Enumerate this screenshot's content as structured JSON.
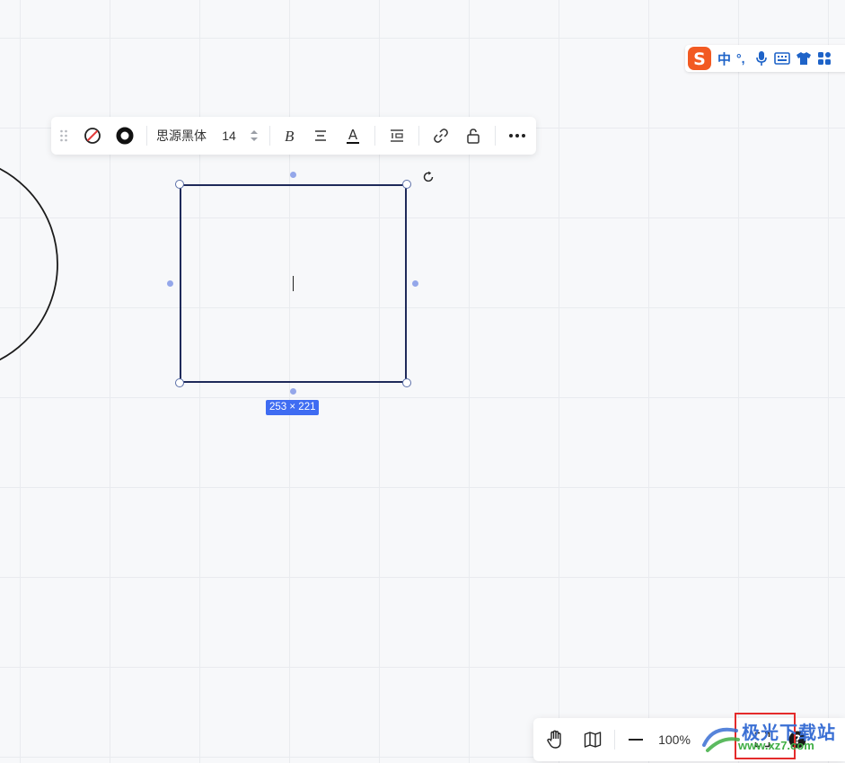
{
  "ime": {
    "lang": "中",
    "punct": "°,",
    "icons": [
      "sogou-logo-icon",
      "microphone-icon",
      "keyboard-icon",
      "skin-shirt-icon",
      "apps-grid-icon"
    ]
  },
  "toolbar": {
    "font_name": "思源黑体",
    "font_size": "14",
    "icons": [
      "drag-handle-icon",
      "no-fill-icon",
      "border-color-icon",
      "font-size-stepper-icon",
      "bold-icon",
      "align-icon",
      "text-color-icon",
      "line-spacing-icon",
      "link-icon",
      "unlock-icon",
      "more-icon"
    ],
    "text_color": "#111111",
    "fill_none_color": "#e43b3b"
  },
  "canvas": {
    "size_label": "253 × 221",
    "selection_color": "#1f2a5a",
    "handle_color": "#94a7ea"
  },
  "zoombar": {
    "zoom_level": "100%",
    "icons": [
      "hand-pan-icon",
      "map-icon",
      "zoom-out-icon",
      "fit-screen-icon",
      "help-icon"
    ]
  },
  "watermark": {
    "text": "极光下载站",
    "url": "www.xz7.com"
  }
}
